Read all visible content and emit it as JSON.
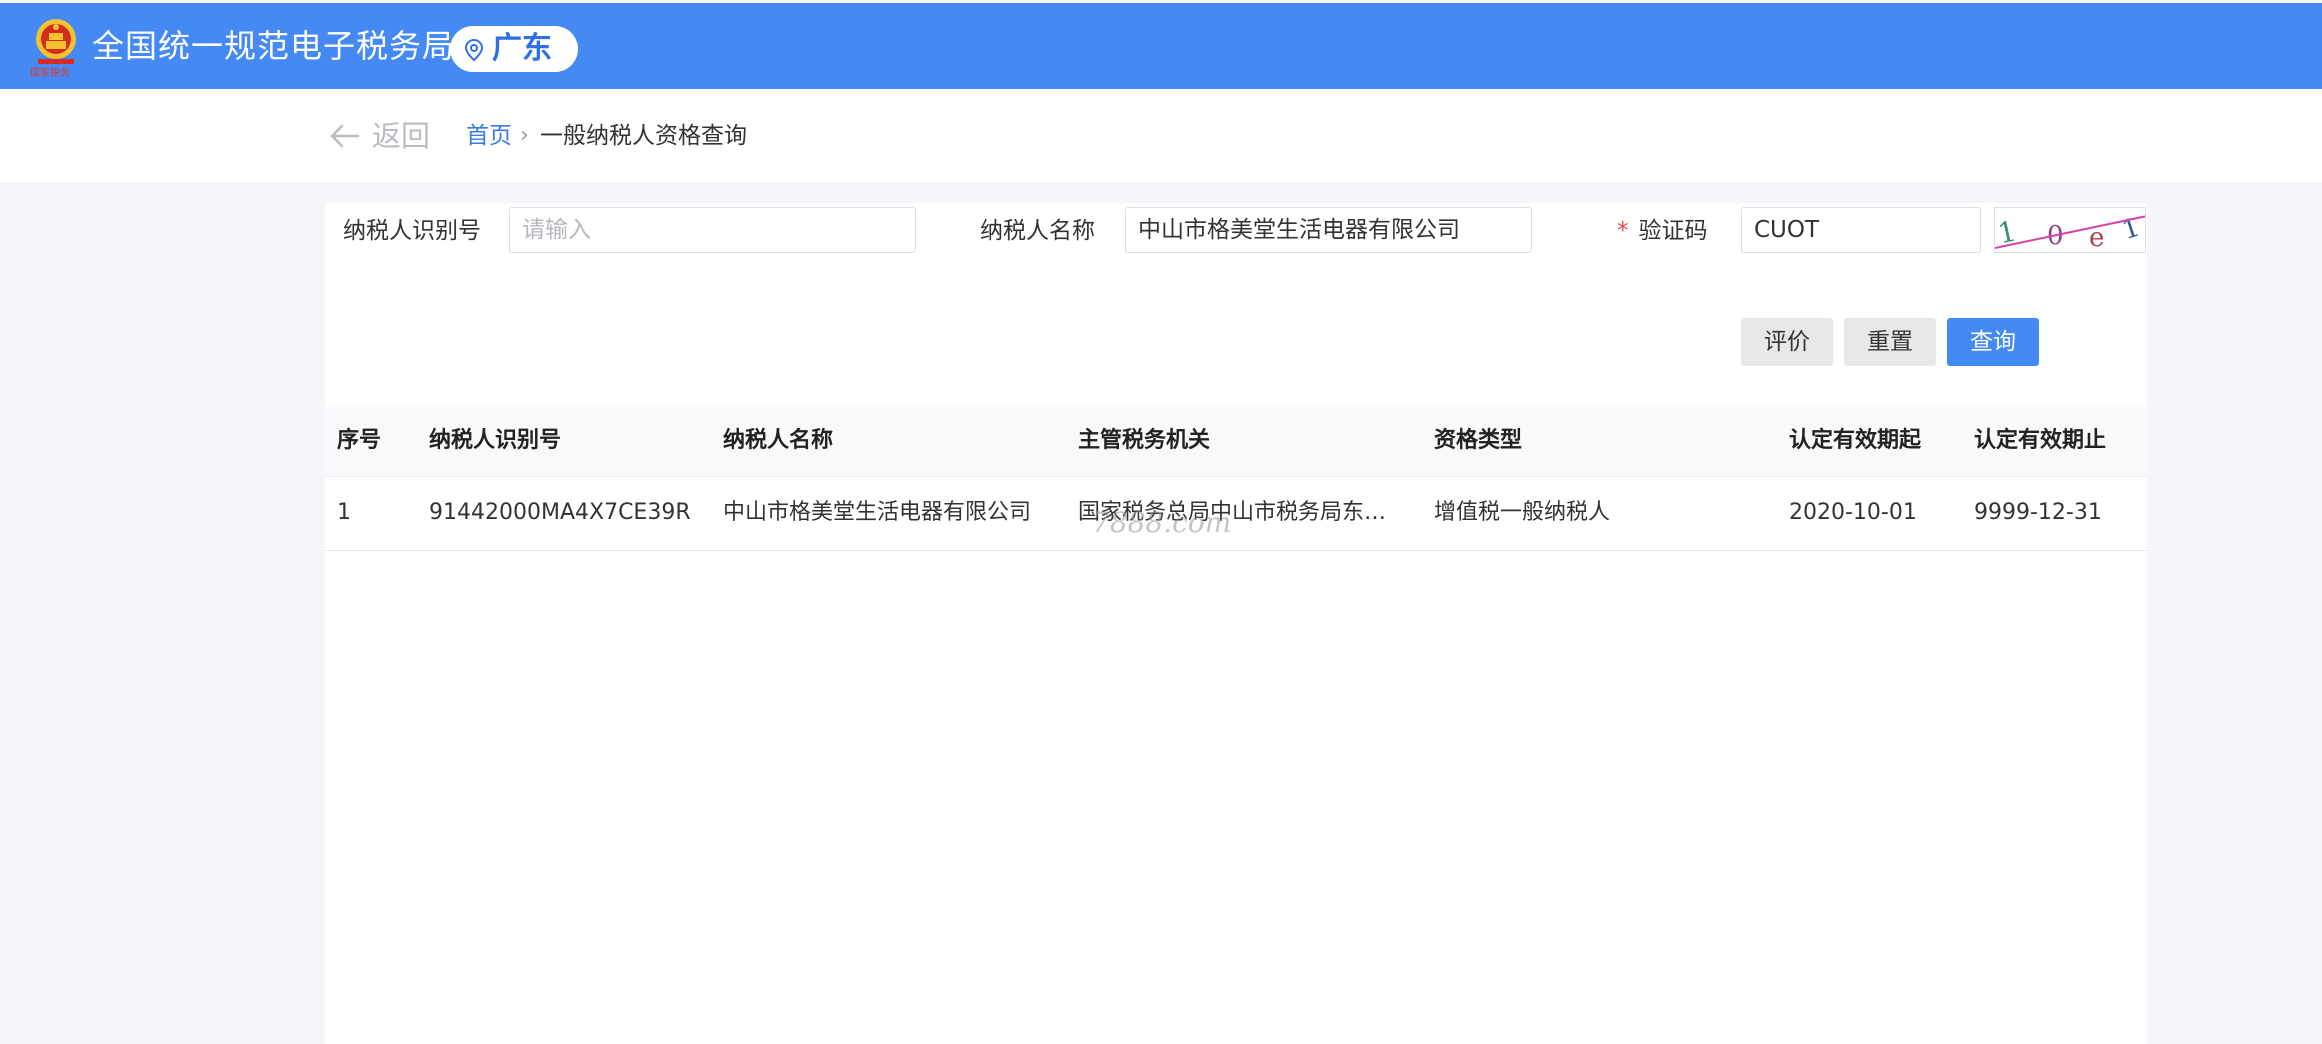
{
  "header": {
    "title": "全国统一规范电子税务局",
    "region": "广东",
    "emblem_icon": "national-emblem-icon",
    "pin_icon": "location-pin-icon",
    "emblem_caption": "国家税务"
  },
  "breadcrumb": {
    "back_label": "返回",
    "home": "首页",
    "separator": "›",
    "current": "一般纳税人资格查询"
  },
  "form": {
    "taxpayer_id_label": "纳税人识别号",
    "taxpayer_id_placeholder": "请输入",
    "taxpayer_id_value": "",
    "taxpayer_name_label": "纳税人名称",
    "taxpayer_name_value": "中山市格美堂生活电器有限公司",
    "captcha_required_mark": "*",
    "captcha_label": "验证码",
    "captcha_value": "CUOT",
    "captcha_image_text": "1 0 e 1"
  },
  "buttons": {
    "evaluate": "评价",
    "reset": "重置",
    "query": "查询"
  },
  "table": {
    "columns": [
      "序号",
      "纳税人识别号",
      "纳税人名称",
      "主管税务机关",
      "资格类型",
      "认定有效期起",
      "认定有效期止"
    ],
    "rows": [
      [
        "1",
        "91442000MA4X7CE39R",
        "中山市格美堂生活电器有限公司",
        "国家税务总局中山市税务局东凤税务分局",
        "增值税一般纳税人",
        "2020-10-01",
        "9999-12-31"
      ]
    ]
  },
  "watermark": "7888.com",
  "colors": {
    "header_bg": "#4589f5",
    "primary": "#4589f5",
    "link": "#3b7be3",
    "required": "#e04b4b"
  }
}
